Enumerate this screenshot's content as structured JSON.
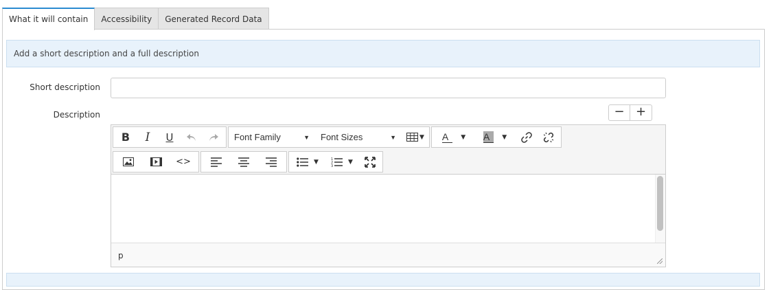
{
  "tabs": [
    {
      "label": "What it will contain",
      "active": true
    },
    {
      "label": "Accessibility",
      "active": false
    },
    {
      "label": "Generated Record Data",
      "active": false
    }
  ],
  "info": {
    "text": "Add a short description and a full description"
  },
  "form": {
    "short_description_label": "Short description",
    "short_description_value": "",
    "description_label": "Description"
  },
  "zoom": {
    "minus": "−",
    "plus": "+"
  },
  "toolbar": {
    "font_family": "Font Family",
    "font_sizes": "Font Sizes",
    "bold": "B",
    "italic": "I",
    "underline": "U",
    "text_color": "A",
    "bg_color": "A",
    "code": "<>"
  },
  "editor": {
    "status_path": "p"
  },
  "colors": {
    "accent": "#2a8bd0",
    "info_bg": "#e8f2fb"
  }
}
